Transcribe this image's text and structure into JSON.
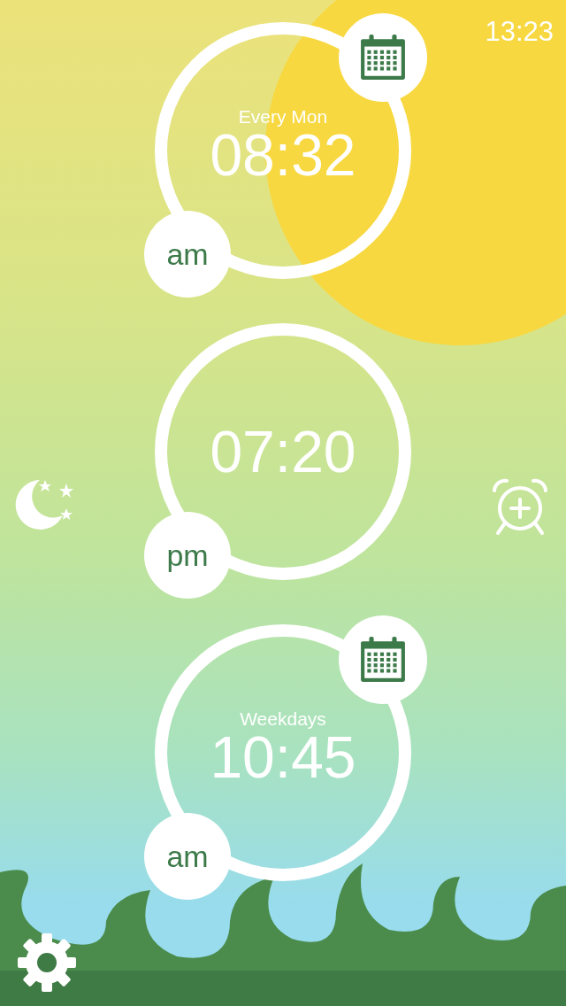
{
  "status_bar": {
    "time": "13:23"
  },
  "alarms": [
    {
      "time": "08:32",
      "period": "am",
      "repeat": "Every Mon",
      "scheduled": true
    },
    {
      "time": "07:20",
      "period": "pm",
      "scheduled": false
    },
    {
      "time": "10:45",
      "period": "am",
      "repeat": "Weekdays",
      "scheduled": true
    }
  ]
}
